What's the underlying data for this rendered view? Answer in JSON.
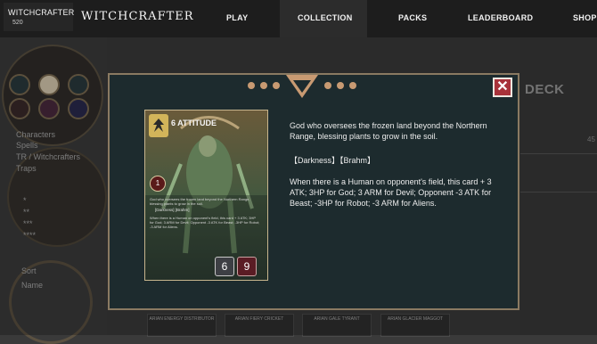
{
  "header": {
    "username": "WITCHCRAFTER",
    "user_level": "520",
    "brand": "WITCHCRAFTER",
    "nav": [
      "PLAY",
      "COLLECTION",
      "PACKS",
      "LEADERBOARD",
      "SHOP"
    ],
    "active_nav": "COLLECTION"
  },
  "sidebar": {
    "categories": [
      "Characters",
      "Spells",
      "TR / Witchcrafters",
      "Traps"
    ],
    "rarities": [
      "*",
      "**",
      "***",
      "****"
    ],
    "sort_label": "Sort",
    "sort_value": "Name"
  },
  "deck_panel": {
    "title": "DECK",
    "partial_value": "45"
  },
  "bottom_cards": [
    "ARIAN ENERGY DISTRIBUTOR",
    "ARIAN FIERY CRICKET",
    "ARIAN GALE TYRANT",
    "ARIAN GLACIER MAGGOT"
  ],
  "modal": {
    "close_label": "✕",
    "card": {
      "name": "6 ATTITUDE",
      "cost": "1",
      "small_text": "God who oversees the frozen land beyond the Northern Range, blessing plants to grow in the soil.",
      "small_tag": "[Darkness] [Brahm]",
      "small_effect": "When there is a Human on opponent's field, this card + 3 ATK; 3HP for God; 3 ARM for Devil; Opponent -3 ATK for Beast; -3HP for Robot; -3 ARM for Aliens.",
      "attack": "6",
      "health": "9"
    },
    "description": "God who oversees the frozen land beyond the Northern Range, blessing plants to grow in the soil.",
    "tags": "【Darkness】【Brahm】",
    "effect": "When there is a Human on opponent's field, this card + 3 ATK; 3HP for God; 3 ARM for Devil; Opponent -3 ATK for Beast; -3HP for Robot; -3 ARM for Aliens."
  },
  "colors": {
    "modal_bg": "#1d2b2e",
    "modal_border": "#8a7a62",
    "close_bg": "#a8323a"
  }
}
